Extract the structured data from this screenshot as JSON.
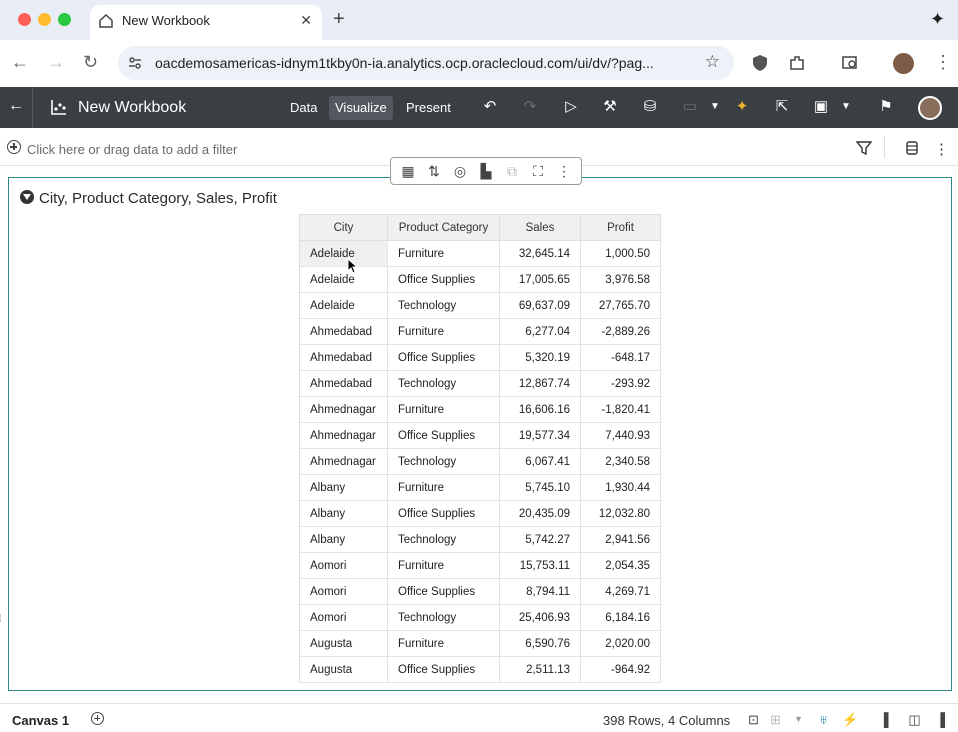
{
  "browser": {
    "tab_title": "New Workbook",
    "url": "oacdemosamericas-idnym1tkby0n-ia.analytics.ocp.oraclecloud.com/ui/dv/?pag..."
  },
  "app": {
    "title": "New Workbook",
    "modes": [
      "Data",
      "Visualize",
      "Present"
    ],
    "active_mode": "Visualize"
  },
  "filter_bar": {
    "hint": "Click here or drag data to add a filter"
  },
  "viz": {
    "title": "City, Product Category, Sales, Profit",
    "columns": [
      "City",
      "Product Category",
      "Sales",
      "Profit"
    ],
    "rows": [
      [
        "Adelaide",
        "Furniture",
        "32,645.14",
        "1,000.50"
      ],
      [
        "Adelaide",
        "Office Supplies",
        "17,005.65",
        "3,976.58"
      ],
      [
        "Adelaide",
        "Technology",
        "69,637.09",
        "27,765.70"
      ],
      [
        "Ahmedabad",
        "Furniture",
        "6,277.04",
        "-2,889.26"
      ],
      [
        "Ahmedabad",
        "Office Supplies",
        "5,320.19",
        "-648.17"
      ],
      [
        "Ahmedabad",
        "Technology",
        "12,867.74",
        "-293.92"
      ],
      [
        "Ahmednagar",
        "Furniture",
        "16,606.16",
        "-1,820.41"
      ],
      [
        "Ahmednagar",
        "Office Supplies",
        "19,577.34",
        "7,440.93"
      ],
      [
        "Ahmednagar",
        "Technology",
        "6,067.41",
        "2,340.58"
      ],
      [
        "Albany",
        "Furniture",
        "5,745.10",
        "1,930.44"
      ],
      [
        "Albany",
        "Office Supplies",
        "20,435.09",
        "12,032.80"
      ],
      [
        "Albany",
        "Technology",
        "5,742.27",
        "2,941.56"
      ],
      [
        "Aomori",
        "Furniture",
        "15,753.11",
        "2,054.35"
      ],
      [
        "Aomori",
        "Office Supplies",
        "8,794.11",
        "4,269.71"
      ],
      [
        "Aomori",
        "Technology",
        "25,406.93",
        "6,184.16"
      ],
      [
        "Augusta",
        "Furniture",
        "6,590.76",
        "2,020.00"
      ],
      [
        "Augusta",
        "Office Supplies",
        "2,511.13",
        "-964.92"
      ]
    ]
  },
  "bottom_bar": {
    "canvas_tab": "Canvas 1",
    "row_count": "398 Rows, 4 Columns"
  },
  "colors": {
    "app_header": "#3a3f44",
    "canvas_border": "#2e8b84"
  }
}
